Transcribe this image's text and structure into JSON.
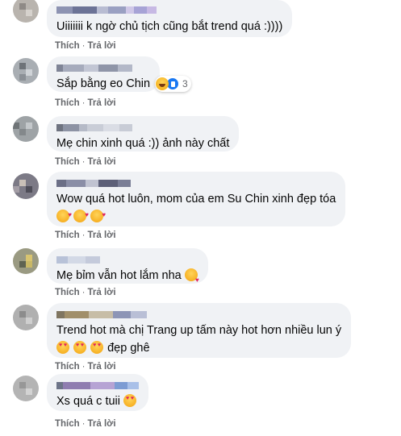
{
  "comments": [
    {
      "text": "Uiiiiiii k ngờ chủ tịch cũng bắt trend quá :))))",
      "like_label": "Thích",
      "reply_label": "Trả lời",
      "emojis": []
    },
    {
      "text": "Sắp bằng eo Chin",
      "like_label": "Thích",
      "reply_label": "Trả lời",
      "reaction_count": "3",
      "reactions": [
        "haha",
        "like"
      ]
    },
    {
      "text": "Mẹ chin xinh quá :)) ảnh này chất",
      "like_label": "Thích",
      "reply_label": "Trả lời"
    },
    {
      "text": "Wow quá hot luôn, mom của em Su Chin xinh đẹp tóa",
      "like_label": "Thích",
      "reply_label": "Trả lời",
      "emojis": [
        "hearts-face",
        "hearts-face",
        "hearts-face"
      ]
    },
    {
      "text": "Mẹ bỉm vẫn hot lắm nha",
      "like_label": "Thích",
      "reply_label": "Trả lời",
      "emojis": [
        "kiss"
      ]
    },
    {
      "text": "Trend hot mà chị Trang up tấm này hot hơn nhiều lun ý",
      "text_line2": "đẹp ghê",
      "like_label": "Thích",
      "reply_label": "Trả lời",
      "emojis": [
        "heart-eyes",
        "heart-eyes",
        "heart-eyes"
      ]
    },
    {
      "text": "Xs quá c tuii",
      "like_label": "Thích",
      "reply_label": "Trả lời",
      "emojis": [
        "heart-eyes"
      ]
    }
  ],
  "separator": "·",
  "colors": {
    "bubble_bg": "#f0f2f5",
    "action_text": "#65676b",
    "like_blue": "#1877f2"
  }
}
